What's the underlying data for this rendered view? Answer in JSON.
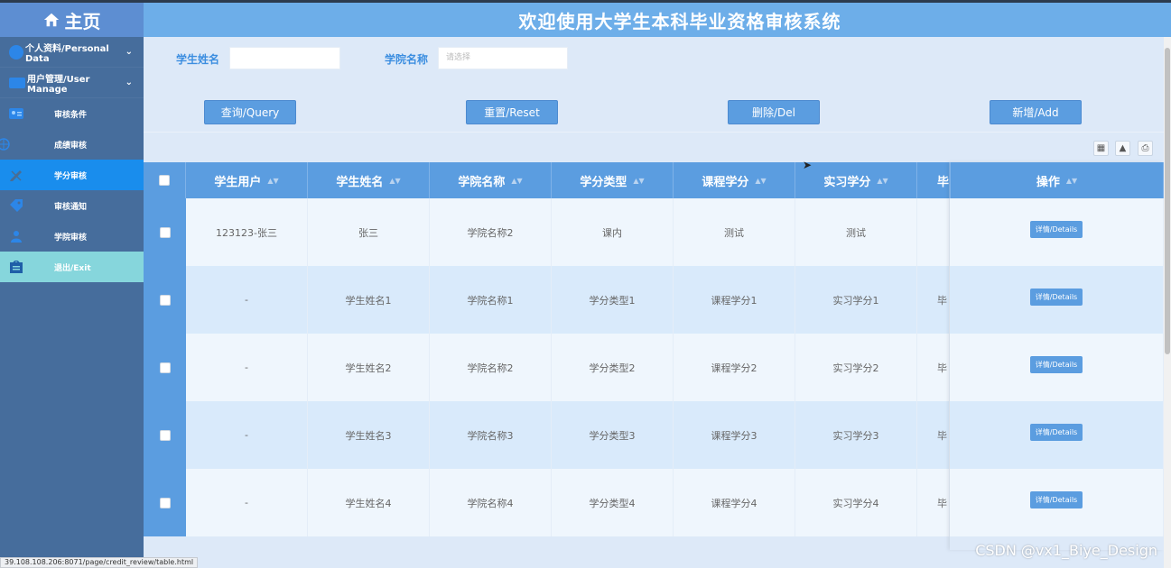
{
  "sidebar": {
    "brand": "主页",
    "groups": [
      {
        "label": "个人资料/Personal Data",
        "icon": "user-circle-icon"
      },
      {
        "label": "用户管理/User Manage",
        "icon": "monitor-icon"
      }
    ],
    "items": [
      {
        "label": "审核条件",
        "icon": "id-card-icon"
      },
      {
        "label": "成绩审核",
        "icon": "globe-icon"
      },
      {
        "label": "学分审核",
        "icon": "pencil-icon"
      },
      {
        "label": "审核通知",
        "icon": "tag-icon"
      },
      {
        "label": "学院审核",
        "icon": "people-icon"
      },
      {
        "label": "退出/Exit",
        "icon": "exit-icon"
      }
    ],
    "active_item": "学分审核"
  },
  "header": {
    "title": "欢迎使用大学生本科毕业资格审核系统"
  },
  "search": {
    "student_name_label": "学生姓名",
    "student_name_value": "",
    "college_label": "学院名称",
    "college_placeholder": "请选择"
  },
  "buttons": {
    "query": "查询/Query",
    "reset": "重置/Reset",
    "delete": "删除/Del",
    "add": "新增/Add"
  },
  "toolbar": {
    "icons": [
      "columns-icon",
      "export-icon",
      "print-icon"
    ]
  },
  "table": {
    "columns": [
      "学生用户",
      "学生姓名",
      "学院名称",
      "学分类型",
      "课程学分",
      "实习学分",
      "毕业",
      "操作"
    ],
    "detail_label": "详情/Details",
    "rows": [
      [
        "123123-张三",
        "张三",
        "学院名称2",
        "课内",
        "测试",
        "测试",
        ""
      ],
      [
        "-",
        "学生姓名1",
        "学院名称1",
        "学分类型1",
        "课程学分1",
        "实习学分1",
        "毕"
      ],
      [
        "-",
        "学生姓名2",
        "学院名称2",
        "学分类型2",
        "课程学分2",
        "实习学分2",
        "毕"
      ],
      [
        "-",
        "学生姓名3",
        "学院名称3",
        "学分类型3",
        "课程学分3",
        "实习学分3",
        "毕"
      ],
      [
        "-",
        "学生姓名4",
        "学院名称4",
        "学分类型4",
        "课程学分4",
        "实习学分4",
        "毕"
      ]
    ]
  },
  "statusbar": {
    "url": "39.108.108.206:8071/page/credit_review/table.html"
  },
  "watermark": "CSDN @vx1_Biye_Design",
  "colors": {
    "sidebar_bg": "#466d9c",
    "accent": "#5b9de0",
    "active": "#198ded",
    "exit": "#86d6dc",
    "header": "#6daee9"
  }
}
